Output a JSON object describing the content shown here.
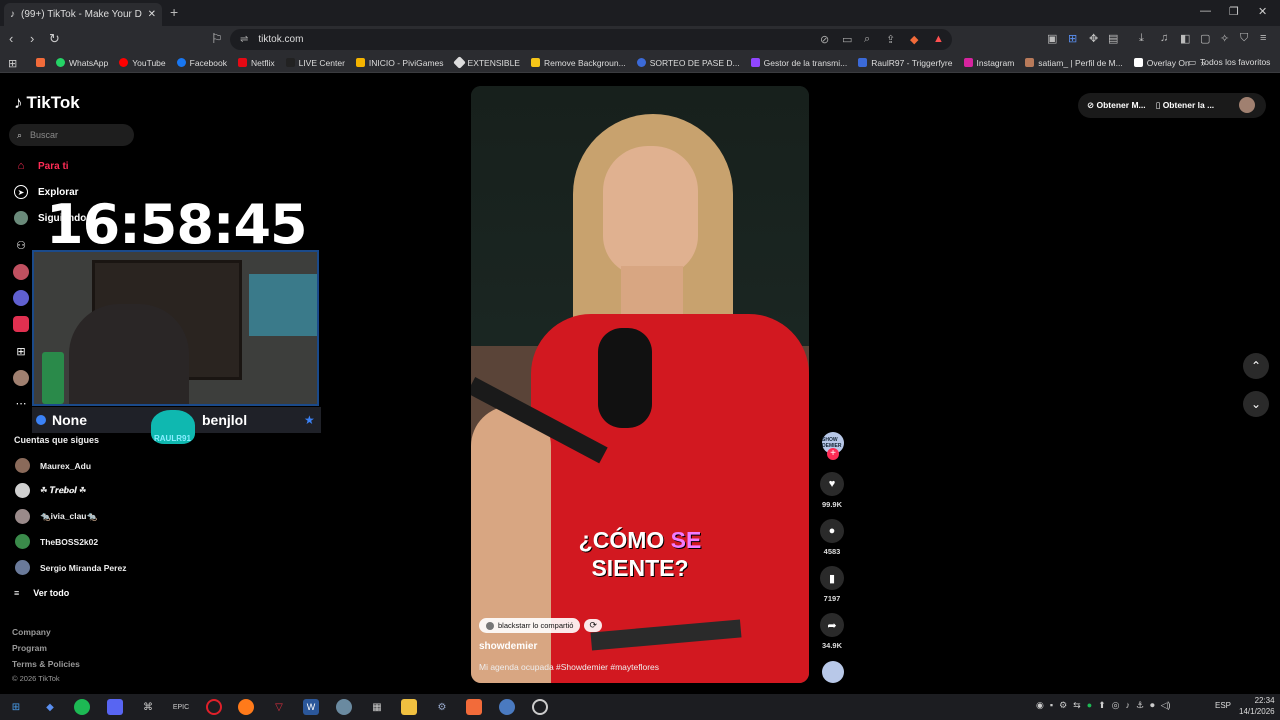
{
  "browser": {
    "tab_title": "(99+) TikTok - Make Your Day",
    "url": "tiktok.com",
    "bookmarks": [
      {
        "label": "WhatsApp",
        "color": "#25d366"
      },
      {
        "label": "YouTube",
        "color": "#ff0000"
      },
      {
        "label": "Facebook",
        "color": "#1877f2"
      },
      {
        "label": "Netflix",
        "color": "#e50914"
      },
      {
        "label": "LIVE Center",
        "color": "#222222"
      },
      {
        "label": "INICIO - PiviGames",
        "color": "#f5b400"
      },
      {
        "label": "EXTENSIBLE",
        "color": "#dddddd"
      },
      {
        "label": "Remove Backgroun...",
        "color": "#f5c518"
      },
      {
        "label": "SORTEO DE PASE D...",
        "color": "#3b6ad8"
      },
      {
        "label": "Gestor de la transmi...",
        "color": "#9146ff"
      },
      {
        "label": "RaulR97 - Triggerfyre",
        "color": "#3b6ad8"
      },
      {
        "label": "Instagram",
        "color": "#d6249f"
      },
      {
        "label": "satiam_ | Perfil de M...",
        "color": "#b87a5a"
      },
      {
        "label": "Overlay On",
        "color": "#ffffff"
      }
    ],
    "favorites_folder": "Todos los favoritos"
  },
  "sidebar": {
    "logo": "TikTok",
    "search_placeholder": "Buscar",
    "nav": [
      {
        "label": "Para ti"
      },
      {
        "label": "Explorar"
      },
      {
        "label": "Siguiendo"
      }
    ],
    "following_header": "Cuentas que sigues",
    "accounts": [
      {
        "name": "Maurex_Adu"
      },
      {
        "name": "☘ 𝑻𝒓𝒆𝒃𝒐𝒍 ☘"
      },
      {
        "name": "🐀ivia_clau🐀"
      },
      {
        "name": "TheBOSS2k02"
      },
      {
        "name": "Sergio Miranda Perez"
      }
    ],
    "see_all": "Ver todo",
    "footer": [
      "Company",
      "Program",
      "Terms & Policies"
    ],
    "copyright": "© 2026 TikTok"
  },
  "overlay": {
    "clock": "16:58:45",
    "left_name": "None",
    "right_name": "benjlol",
    "logo_text": "RAULR91"
  },
  "video": {
    "caption_line1_a": "¿CÓMO",
    "caption_line1_b": "SE",
    "caption_line2": "SIENTE?",
    "repost_label": "blackstarr lo compartió",
    "author": "showdemier",
    "description": "Mi agenda ocupada #Showdemier #mayteflores",
    "avatar_text": "SHOW DEMIER",
    "likes": "99.9K",
    "comments": "4583",
    "saves": "7197",
    "shares": "34.9K"
  },
  "topright": {
    "get_coins": "Obtener M...",
    "get_app": "Obtener la ..."
  },
  "taskbar": {
    "lang": "ESP",
    "time": "22:34",
    "date": "14/1/2026"
  }
}
